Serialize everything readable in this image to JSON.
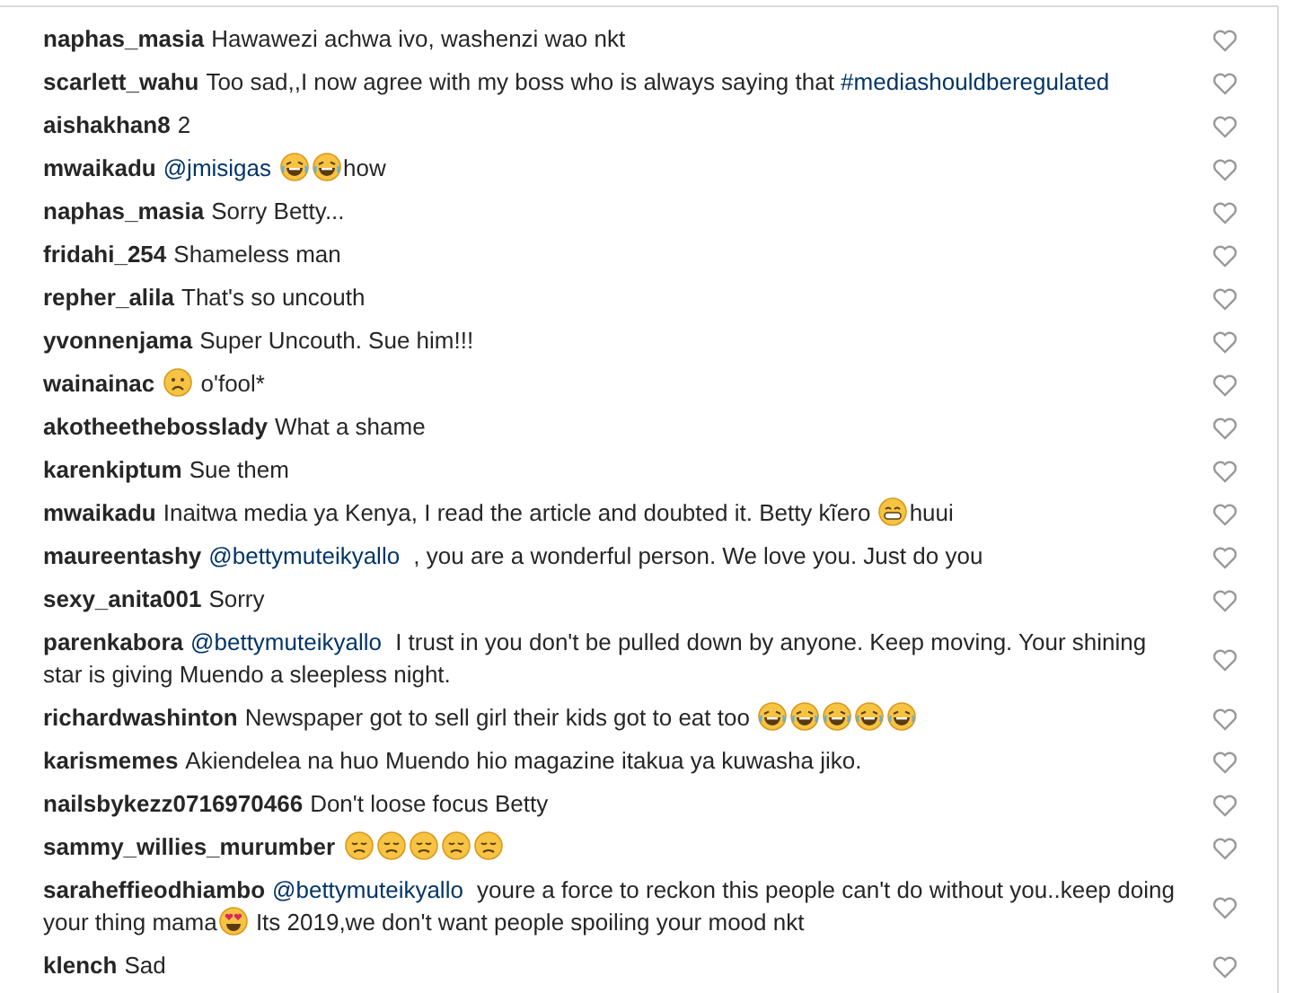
{
  "comments": [
    {
      "username": "naphas_masia",
      "parts": [
        {
          "kind": "text",
          "text": "Hawawezi achwa ivo, washenzi wao nkt"
        }
      ],
      "liked": false
    },
    {
      "username": "scarlett_wahu",
      "parts": [
        {
          "kind": "text",
          "text": "Too sad,,I now agree with my boss who is always saying that "
        },
        {
          "kind": "link",
          "text": "#mediashouldberegulated"
        }
      ],
      "liked": false
    },
    {
      "username": "aishakhan8",
      "parts": [
        {
          "kind": "text",
          "text": "2"
        }
      ],
      "liked": false
    },
    {
      "username": "mwaikadu",
      "parts": [
        {
          "kind": "link",
          "text": "@jmisigas"
        },
        {
          "kind": "emoji-laugh"
        },
        {
          "kind": "emoji-laugh"
        },
        {
          "kind": "text",
          "text": "how"
        }
      ],
      "liked": false
    },
    {
      "username": "naphas_masia",
      "parts": [
        {
          "kind": "text",
          "text": "Sorry Betty..."
        }
      ],
      "liked": false
    },
    {
      "username": "fridahi_254",
      "parts": [
        {
          "kind": "text",
          "text": "Shameless man"
        }
      ],
      "liked": false
    },
    {
      "username": "repher_alila",
      "parts": [
        {
          "kind": "text",
          "text": "That's so uncouth"
        }
      ],
      "liked": false
    },
    {
      "username": "yvonnenjama",
      "parts": [
        {
          "kind": "text",
          "text": "Super Uncouth. Sue him!!!"
        }
      ],
      "liked": false
    },
    {
      "username": "wainainac",
      "parts": [
        {
          "kind": "emoji-frown"
        },
        {
          "kind": "text",
          "text": " o'fool*"
        }
      ],
      "liked": false
    },
    {
      "username": "akotheethebosslady",
      "parts": [
        {
          "kind": "text",
          "text": "What a shame"
        }
      ],
      "liked": false
    },
    {
      "username": "karenkiptum",
      "parts": [
        {
          "kind": "text",
          "text": "Sue them"
        }
      ],
      "liked": false
    },
    {
      "username": "mwaikadu",
      "parts": [
        {
          "kind": "text",
          "text": "Inaitwa media ya Kenya, I read the article and doubted it. Betty kĩero "
        },
        {
          "kind": "emoji-grin"
        },
        {
          "kind": "text",
          "text": "huui"
        }
      ],
      "liked": false
    },
    {
      "username": "maureentashy",
      "parts": [
        {
          "kind": "link",
          "text": "@bettymuteikyallo"
        },
        {
          "kind": "text",
          "text": " , you are a wonderful person. We love you. Just do you"
        }
      ],
      "liked": false
    },
    {
      "username": "sexy_anita001",
      "parts": [
        {
          "kind": "text",
          "text": "Sorry"
        }
      ],
      "liked": false
    },
    {
      "username": "parenkabora",
      "parts": [
        {
          "kind": "link",
          "text": "@bettymuteikyallo"
        },
        {
          "kind": "text",
          "text": " I trust in you don't be pulled down by anyone. Keep moving. Your shining star is giving Muendo a sleepless night."
        }
      ],
      "liked": false
    },
    {
      "username": "richardwashinton",
      "parts": [
        {
          "kind": "text",
          "text": "Newspaper got to sell girl their kids got to eat too "
        },
        {
          "kind": "emoji-laugh"
        },
        {
          "kind": "emoji-laugh"
        },
        {
          "kind": "emoji-laugh"
        },
        {
          "kind": "emoji-laugh"
        },
        {
          "kind": "emoji-laugh"
        }
      ],
      "liked": false
    },
    {
      "username": "karismemes",
      "parts": [
        {
          "kind": "text",
          "text": "Akiendelea na huo Muendo hio magazine itakua ya kuwasha jiko."
        }
      ],
      "liked": false
    },
    {
      "username": "nailsbykezz0716970466",
      "parts": [
        {
          "kind": "text",
          "text": "Don't loose focus Betty"
        }
      ],
      "liked": false
    },
    {
      "username": "sammy_willies_murumber",
      "parts": [
        {
          "kind": "emoji-sad"
        },
        {
          "kind": "emoji-sad"
        },
        {
          "kind": "emoji-sad"
        },
        {
          "kind": "emoji-sad"
        },
        {
          "kind": "emoji-sad"
        }
      ],
      "liked": false
    },
    {
      "username": "saraheffieodhiambo",
      "parts": [
        {
          "kind": "link",
          "text": "@bettymuteikyallo"
        },
        {
          "kind": "text",
          "text": " youre a force to reckon this people can't do without you..keep doing your thing mama"
        },
        {
          "kind": "emoji-hearteyes"
        },
        {
          "kind": "text",
          "text": " Its 2019,we don't want people spoiling your mood nkt"
        }
      ],
      "liked": false
    },
    {
      "username": "klench",
      "parts": [
        {
          "kind": "text",
          "text": "Sad"
        }
      ],
      "liked": false
    }
  ]
}
